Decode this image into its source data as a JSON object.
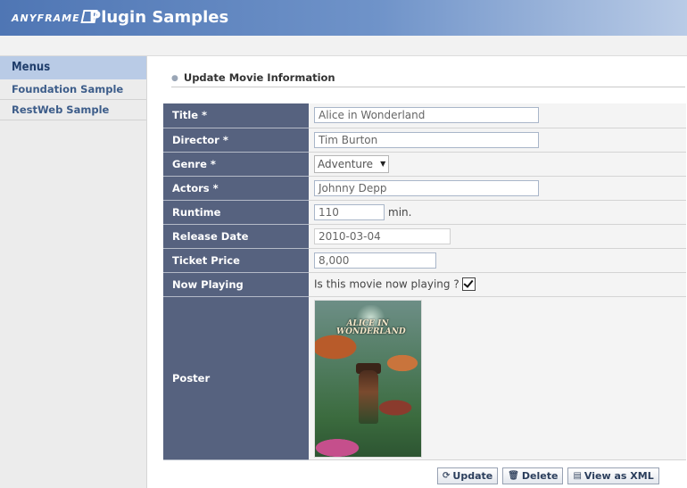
{
  "header": {
    "logo": "ANYFRAME",
    "title": "Plugin Samples"
  },
  "sidebar": {
    "heading": "Menus",
    "items": [
      {
        "label": "Foundation Sample"
      },
      {
        "label": "RestWeb Sample"
      }
    ]
  },
  "main": {
    "section_title": "Update Movie Information",
    "fields": {
      "title": {
        "label": "Title *",
        "value": "Alice in Wonderland"
      },
      "director": {
        "label": "Director *",
        "value": "Tim Burton"
      },
      "genre": {
        "label": "Genre *",
        "value": "Adventure"
      },
      "actors": {
        "label": "Actors *",
        "value": "Johnny Depp"
      },
      "runtime": {
        "label": "Runtime",
        "value": "110",
        "unit": "min."
      },
      "release_date": {
        "label": "Release Date",
        "value": "2010-03-04"
      },
      "ticket_price": {
        "label": "Ticket Price",
        "value": "8,000"
      },
      "now_playing": {
        "label": "Now Playing",
        "question": "Is this movie now playing ?",
        "checked": true
      },
      "poster": {
        "label": "Poster",
        "image_title": "ALICE IN WONDERLAND"
      }
    },
    "buttons": {
      "update": "Update",
      "delete": "Delete",
      "view_xml": "View as XML"
    }
  },
  "colors": {
    "header": "#4f76b4",
    "label_bg": "#56627f",
    "menu_head": "#b9cbe6"
  }
}
